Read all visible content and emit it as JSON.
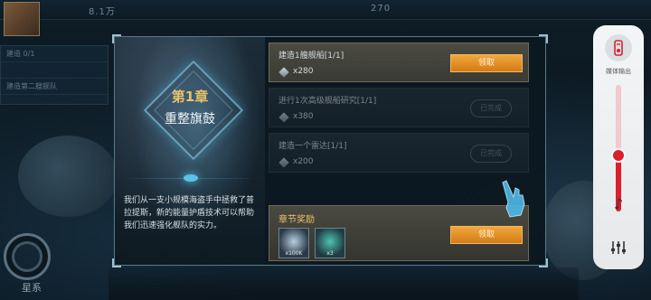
{
  "hud": {
    "top_stat": "8.1万",
    "top_stat2": "270",
    "left_rows": [
      "建造 0/1",
      "",
      "建造第二艘舰队"
    ],
    "planet_label": "星系"
  },
  "chapter": {
    "number": "第1章",
    "name": "重整旗鼓",
    "story": "我们从一支小规模海盗手中拯救了普拉提斯，新的能量护盾技术可以帮助我们迅速强化舰队的实力。"
  },
  "quests": [
    {
      "title": "建造1艘舰船[1/1]",
      "amount": "x280",
      "state": "claimable",
      "button": "领取"
    },
    {
      "title": "进行1次高级舰船研究[1/1]",
      "amount": "x380",
      "state": "done",
      "stamp": "已完成"
    },
    {
      "title": "建造一个雷达[1/1]",
      "amount": "x200",
      "state": "done",
      "stamp": "已完成"
    }
  ],
  "chapter_reward": {
    "title": "章节奖励",
    "items": [
      {
        "icon": "energy-crystal-icon",
        "count": "x100K"
      },
      {
        "icon": "shield-module-icon",
        "count": "x3"
      }
    ],
    "button": "领取"
  },
  "media_panel": {
    "label": "媒体输出",
    "volume_percent": 44,
    "accent": "#d9202f"
  }
}
